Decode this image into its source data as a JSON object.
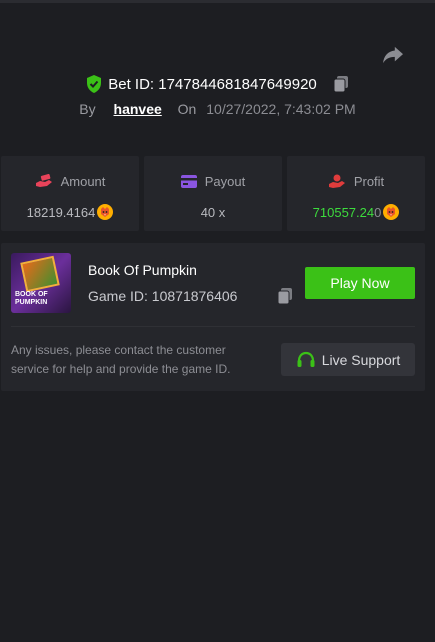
{
  "bet": {
    "label": "Bet ID: 1747844681847649920",
    "by_label": "By",
    "user": "hanvee",
    "on_label": "On",
    "date": "10/27/2022, 7:43:02 PM"
  },
  "stats": [
    {
      "label": "Amount",
      "value": "18219.4164",
      "icon": "money-hand-icon"
    },
    {
      "label": "Payout",
      "value": "40 x",
      "icon": "credit-card-icon"
    },
    {
      "label": "Profit",
      "value_green": "710557.24",
      "value_dim": "0",
      "icon": "profit-hand-icon"
    }
  ],
  "game": {
    "title": "Book Of Pumpkin",
    "id_label": "Game ID: 10871876406",
    "thumb_text": "BOOK OF PUMPKIN",
    "play_label": "Play Now",
    "issue_text": "Any issues, please contact the customer service for help and provide the game ID.",
    "support_label": "Live Support"
  },
  "colors": {
    "accent_green": "#3bc117",
    "profit_green": "#3ddc3d",
    "amount_icon": "#e8435a",
    "payout_icon": "#8a55e0",
    "profit_icon": "#e03c3c",
    "coin": "#ffae00"
  }
}
